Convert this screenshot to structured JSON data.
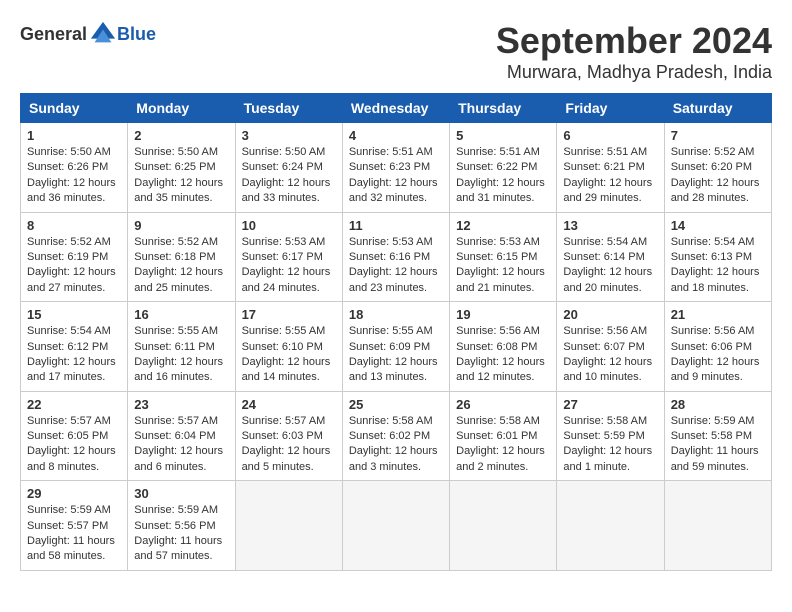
{
  "header": {
    "logo_general": "General",
    "logo_blue": "Blue",
    "title": "September 2024",
    "subtitle": "Murwara, Madhya Pradesh, India"
  },
  "calendar": {
    "days_of_week": [
      "Sunday",
      "Monday",
      "Tuesday",
      "Wednesday",
      "Thursday",
      "Friday",
      "Saturday"
    ],
    "weeks": [
      [
        {
          "day": "",
          "info": ""
        },
        {
          "day": "2",
          "info": "Sunrise: 5:50 AM\nSunset: 6:25 PM\nDaylight: 12 hours\nand 35 minutes."
        },
        {
          "day": "3",
          "info": "Sunrise: 5:50 AM\nSunset: 6:24 PM\nDaylight: 12 hours\nand 33 minutes."
        },
        {
          "day": "4",
          "info": "Sunrise: 5:51 AM\nSunset: 6:23 PM\nDaylight: 12 hours\nand 32 minutes."
        },
        {
          "day": "5",
          "info": "Sunrise: 5:51 AM\nSunset: 6:22 PM\nDaylight: 12 hours\nand 31 minutes."
        },
        {
          "day": "6",
          "info": "Sunrise: 5:51 AM\nSunset: 6:21 PM\nDaylight: 12 hours\nand 29 minutes."
        },
        {
          "day": "7",
          "info": "Sunrise: 5:52 AM\nSunset: 6:20 PM\nDaylight: 12 hours\nand 28 minutes."
        }
      ],
      [
        {
          "day": "1",
          "info": "Sunrise: 5:50 AM\nSunset: 6:26 PM\nDaylight: 12 hours\nand 36 minutes."
        },
        {
          "day": "",
          "info": ""
        },
        {
          "day": "",
          "info": ""
        },
        {
          "day": "",
          "info": ""
        },
        {
          "day": "",
          "info": ""
        },
        {
          "day": "",
          "info": ""
        },
        {
          "day": "",
          "info": ""
        }
      ],
      [
        {
          "day": "8",
          "info": "Sunrise: 5:52 AM\nSunset: 6:19 PM\nDaylight: 12 hours\nand 27 minutes."
        },
        {
          "day": "9",
          "info": "Sunrise: 5:52 AM\nSunset: 6:18 PM\nDaylight: 12 hours\nand 25 minutes."
        },
        {
          "day": "10",
          "info": "Sunrise: 5:53 AM\nSunset: 6:17 PM\nDaylight: 12 hours\nand 24 minutes."
        },
        {
          "day": "11",
          "info": "Sunrise: 5:53 AM\nSunset: 6:16 PM\nDaylight: 12 hours\nand 23 minutes."
        },
        {
          "day": "12",
          "info": "Sunrise: 5:53 AM\nSunset: 6:15 PM\nDaylight: 12 hours\nand 21 minutes."
        },
        {
          "day": "13",
          "info": "Sunrise: 5:54 AM\nSunset: 6:14 PM\nDaylight: 12 hours\nand 20 minutes."
        },
        {
          "day": "14",
          "info": "Sunrise: 5:54 AM\nSunset: 6:13 PM\nDaylight: 12 hours\nand 18 minutes."
        }
      ],
      [
        {
          "day": "15",
          "info": "Sunrise: 5:54 AM\nSunset: 6:12 PM\nDaylight: 12 hours\nand 17 minutes."
        },
        {
          "day": "16",
          "info": "Sunrise: 5:55 AM\nSunset: 6:11 PM\nDaylight: 12 hours\nand 16 minutes."
        },
        {
          "day": "17",
          "info": "Sunrise: 5:55 AM\nSunset: 6:10 PM\nDaylight: 12 hours\nand 14 minutes."
        },
        {
          "day": "18",
          "info": "Sunrise: 5:55 AM\nSunset: 6:09 PM\nDaylight: 12 hours\nand 13 minutes."
        },
        {
          "day": "19",
          "info": "Sunrise: 5:56 AM\nSunset: 6:08 PM\nDaylight: 12 hours\nand 12 minutes."
        },
        {
          "day": "20",
          "info": "Sunrise: 5:56 AM\nSunset: 6:07 PM\nDaylight: 12 hours\nand 10 minutes."
        },
        {
          "day": "21",
          "info": "Sunrise: 5:56 AM\nSunset: 6:06 PM\nDaylight: 12 hours\nand 9 minutes."
        }
      ],
      [
        {
          "day": "22",
          "info": "Sunrise: 5:57 AM\nSunset: 6:05 PM\nDaylight: 12 hours\nand 8 minutes."
        },
        {
          "day": "23",
          "info": "Sunrise: 5:57 AM\nSunset: 6:04 PM\nDaylight: 12 hours\nand 6 minutes."
        },
        {
          "day": "24",
          "info": "Sunrise: 5:57 AM\nSunset: 6:03 PM\nDaylight: 12 hours\nand 5 minutes."
        },
        {
          "day": "25",
          "info": "Sunrise: 5:58 AM\nSunset: 6:02 PM\nDaylight: 12 hours\nand 3 minutes."
        },
        {
          "day": "26",
          "info": "Sunrise: 5:58 AM\nSunset: 6:01 PM\nDaylight: 12 hours\nand 2 minutes."
        },
        {
          "day": "27",
          "info": "Sunrise: 5:58 AM\nSunset: 5:59 PM\nDaylight: 12 hours\nand 1 minute."
        },
        {
          "day": "28",
          "info": "Sunrise: 5:59 AM\nSunset: 5:58 PM\nDaylight: 11 hours\nand 59 minutes."
        }
      ],
      [
        {
          "day": "29",
          "info": "Sunrise: 5:59 AM\nSunset: 5:57 PM\nDaylight: 11 hours\nand 58 minutes."
        },
        {
          "day": "30",
          "info": "Sunrise: 5:59 AM\nSunset: 5:56 PM\nDaylight: 11 hours\nand 57 minutes."
        },
        {
          "day": "",
          "info": ""
        },
        {
          "day": "",
          "info": ""
        },
        {
          "day": "",
          "info": ""
        },
        {
          "day": "",
          "info": ""
        },
        {
          "day": "",
          "info": ""
        }
      ]
    ]
  }
}
